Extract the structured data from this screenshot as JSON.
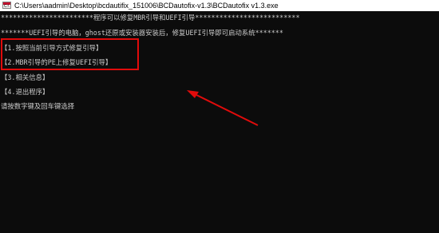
{
  "window": {
    "title": "C:\\Users\\aadmin\\Desktop\\bcdautifix_151006\\BCDautofix-v1.3\\BCDautofix v1.3.exe",
    "icon": "console-window-icon"
  },
  "console": {
    "header_line": "***********************程序可以修复MBR引导和UEFI引导**************************",
    "info_line": "*******UEFI引导的电脑，ghost还原或安装器安装后，修复UEFI引导即可启动系统*******",
    "menu": [
      "【1.按照当前引导方式修复引导】",
      "【2.MBR引导的PE上修复UEFI引导】",
      "【3.相关信息】",
      "【4.退出程序】"
    ],
    "prompt": "请按数字键及回车键选择"
  },
  "annotation": {
    "box_color": "#e10b0b",
    "arrow_color": "#e10b0b"
  }
}
